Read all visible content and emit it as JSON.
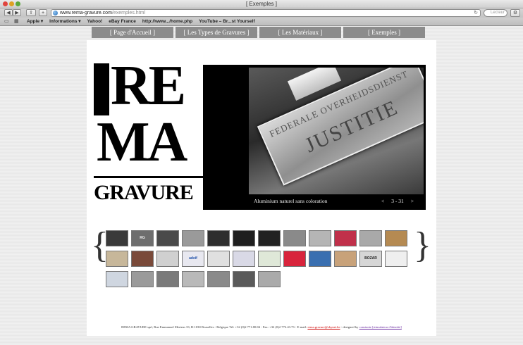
{
  "window": {
    "title": "[ Exemples ]"
  },
  "toolbar": {
    "back_label": "◀",
    "forward_label": "▶",
    "share_label": "⇪",
    "add_tab_label": "+",
    "url_host": "www.rema-gravure.com",
    "url_path": "/exemples.html",
    "reload_icon": "↻",
    "search_placeholder": "Lecteur",
    "gear_label": "⚙"
  },
  "bookmarks": {
    "items": [
      {
        "label": "Apple ▾"
      },
      {
        "label": "Informations ▾"
      },
      {
        "label": "Yahoo!"
      },
      {
        "label": "eBay France"
      },
      {
        "label": "http://www.../home.php"
      },
      {
        "label": "YouTube – Br...st Yourself"
      }
    ]
  },
  "nav": {
    "tabs": [
      {
        "label": "[ Page d'Accueil ]"
      },
      {
        "label": "[ Les Types de Gravures ]"
      },
      {
        "label": "[ Les Matériaux ]"
      },
      {
        "label": "[ Exemples ]"
      }
    ]
  },
  "logo": {
    "line1": "RE",
    "line2": "MA",
    "line3": "GRAVURE"
  },
  "slideshow": {
    "plate_line1": "FEDERALE OVERHEIDSDIENST",
    "plate_line2": "JUSTITIE",
    "caption": "Aluminium naturel sans coloration",
    "prev_label": "<",
    "counter": "3 - 31",
    "next_label": ">"
  },
  "gallery": {
    "left_bracket": "{",
    "right_bracket": "}",
    "thumbnails": [
      {
        "bg": "#3a3a3a",
        "fg": "#ddd",
        "text": ""
      },
      {
        "bg": "#6e6e6e",
        "fg": "#eee",
        "text": "RG"
      },
      {
        "bg": "#4a4a4a",
        "fg": "#ccc",
        "text": ""
      },
      {
        "bg": "#9a9a9a",
        "fg": "#333",
        "text": ""
      },
      {
        "bg": "#2e2e2e",
        "fg": "#ccc",
        "text": ""
      },
      {
        "bg": "#1f1f1f",
        "fg": "#bbb",
        "text": ""
      },
      {
        "bg": "#222222",
        "fg": "#ddd",
        "text": ""
      },
      {
        "bg": "#8a8a8a",
        "fg": "#333",
        "text": ""
      },
      {
        "bg": "#b5b5b5",
        "fg": "#555",
        "text": ""
      },
      {
        "bg": "#c0304a",
        "fg": "#fff",
        "text": ""
      },
      {
        "bg": "#a9a9a9",
        "fg": "#444",
        "text": ""
      },
      {
        "bg": "#b58a52",
        "fg": "#fff",
        "text": ""
      },
      {
        "bg": "#c7b79a",
        "fg": "#333",
        "text": ""
      },
      {
        "bg": "#7a4a3a",
        "fg": "#fff",
        "text": ""
      },
      {
        "bg": "#d0d0d0",
        "fg": "#333",
        "text": ""
      },
      {
        "bg": "#e8e8f0",
        "fg": "#1e4fa8",
        "text": "adeif"
      },
      {
        "bg": "#e0e0e0",
        "fg": "#333",
        "text": ""
      },
      {
        "bg": "#d9d9e6",
        "fg": "#2a3f8f",
        "text": ""
      },
      {
        "bg": "#dfe8d8",
        "fg": "#333",
        "text": ""
      },
      {
        "bg": "#d8243c",
        "fg": "#fff",
        "text": ""
      },
      {
        "bg": "#3a6fb0",
        "fg": "#fff",
        "text": ""
      },
      {
        "bg": "#c8a27a",
        "fg": "#333",
        "text": ""
      },
      {
        "bg": "#d6d6d6",
        "fg": "#222",
        "text": "BOZAR"
      },
      {
        "bg": "#efefef",
        "fg": "#555",
        "text": ""
      },
      {
        "bg": "#cfd6e0",
        "fg": "#333",
        "text": ""
      },
      {
        "bg": "#9a9a9a",
        "fg": "#333",
        "text": ""
      },
      {
        "bg": "#7a7a7a",
        "fg": "#ddd",
        "text": ""
      },
      {
        "bg": "#b9b9b9",
        "fg": "#444",
        "text": ""
      },
      {
        "bg": "#8a8a8a",
        "fg": "#ddd",
        "text": ""
      },
      {
        "bg": "#5a5a5a",
        "fg": "#ddd",
        "text": ""
      },
      {
        "bg": "#aaaaaa",
        "fg": "#333",
        "text": ""
      }
    ]
  },
  "footer": {
    "text": "REMA GRAVURE sprl, Rue Emmanuel Mertens 33, B-1030 Bruxelles - Belgique Tél: +32 (0)2 771.80.84 - Fax: +32 (0)2 772.43.73 - E-mail:",
    "email": "rema.gravure@skynet.be",
    "designed_by": " - designed by",
    "designer": "constante [stimulateur d'identité]"
  }
}
